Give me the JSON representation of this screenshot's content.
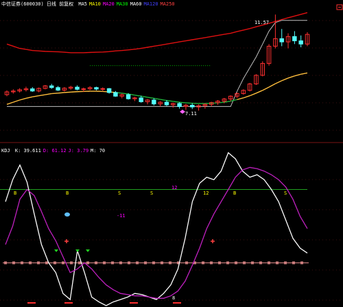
{
  "main_header": {
    "title": "中信证券(600030) 日线 前复权",
    "indicators": [
      {
        "label": "MA5",
        "color": "#ffffff"
      },
      {
        "label": "MA10",
        "color": "#ffff00"
      },
      {
        "label": "MA20",
        "color": "#ff00ff"
      },
      {
        "label": "MA30",
        "color": "#00ff00"
      },
      {
        "label": "MA60",
        "color": "#ffffff"
      },
      {
        "label": "MA120",
        "color": "#4040ff"
      },
      {
        "label": "MA250",
        "color": "#ff4040"
      }
    ]
  },
  "main_annotations": {
    "high_label": "11.57",
    "low_label": "7.11"
  },
  "sub_header": {
    "title": "KDJ",
    "params": [
      {
        "label": "K: 39.611",
        "color": "#ffffff"
      },
      {
        "label": "D: 61.12",
        "color": "#ff00ff"
      },
      {
        "label": "J: 3.79",
        "color": "#ff00ff"
      },
      {
        "label": "M: 70",
        "color": "#ffffff"
      }
    ]
  },
  "signal_labels": [
    {
      "text": "B",
      "color": "#ffff00"
    },
    {
      "text": "B",
      "color": "#ffff00"
    },
    {
      "text": "S",
      "color": "#ffff00"
    },
    {
      "text": "S",
      "color": "#ffff00"
    },
    {
      "text": "12",
      "color": "#ffff00"
    },
    {
      "text": "B",
      "color": "#ffff00"
    },
    {
      "text": "S",
      "color": "#ffff00"
    },
    {
      "text": "12",
      "color": "#ff00ff"
    },
    {
      "text": "-11",
      "color": "#ff00ff"
    },
    {
      "text": "8",
      "color": "#ffffff"
    }
  ],
  "colors": {
    "background": "#000000",
    "up_candle": "#ff3030",
    "down_candle": "#54ffff",
    "ma_long": "#e01010",
    "ma_mid": "#ffbe3c",
    "ma_short_green": "#1eb43c",
    "band": "#c0c0c0",
    "dotted_guide": "#00c000",
    "kdj_k": "#ffffff",
    "kdj_d": "#c020c0",
    "level_line": "#20a020",
    "pink_markers": "#d08080",
    "grid_red": "#802020"
  },
  "chart_data": [
    {
      "type": "candlestick",
      "title": "",
      "candles_ohlc": [
        [
          7.85,
          8.05,
          7.78,
          7.98
        ],
        [
          7.98,
          8.1,
          7.9,
          8.02
        ],
        [
          8.02,
          8.15,
          7.95,
          8.08
        ],
        [
          8.08,
          8.22,
          8.0,
          8.12
        ],
        [
          8.12,
          8.2,
          7.98,
          8.02
        ],
        [
          8.02,
          8.18,
          7.96,
          8.14
        ],
        [
          8.14,
          8.3,
          8.1,
          8.26
        ],
        [
          8.26,
          8.35,
          8.12,
          8.18
        ],
        [
          8.18,
          8.25,
          8.02,
          8.06
        ],
        [
          8.06,
          8.2,
          8.0,
          8.15
        ],
        [
          8.15,
          8.26,
          8.08,
          8.2
        ],
        [
          8.2,
          8.28,
          8.05,
          8.1
        ],
        [
          8.1,
          8.18,
          7.98,
          8.12
        ],
        [
          8.12,
          8.24,
          8.06,
          8.18
        ],
        [
          8.18,
          8.22,
          8.05,
          8.11
        ],
        [
          8.11,
          8.19,
          8.02,
          8.13
        ],
        [
          8.13,
          8.16,
          7.9,
          7.95
        ],
        [
          7.95,
          8.02,
          7.75,
          7.78
        ],
        [
          7.78,
          7.9,
          7.68,
          7.85
        ],
        [
          7.85,
          7.92,
          7.62,
          7.66
        ],
        [
          7.66,
          7.75,
          7.55,
          7.7
        ],
        [
          7.7,
          7.8,
          7.48,
          7.52
        ],
        [
          7.52,
          7.65,
          7.4,
          7.6
        ],
        [
          7.6,
          7.68,
          7.35,
          7.42
        ],
        [
          7.42,
          7.55,
          7.3,
          7.5
        ],
        [
          7.5,
          7.6,
          7.32,
          7.38
        ],
        [
          7.38,
          7.48,
          7.25,
          7.44
        ],
        [
          7.44,
          7.5,
          7.2,
          7.3
        ],
        [
          7.3,
          7.42,
          7.15,
          7.36
        ],
        [
          7.36,
          7.45,
          7.18,
          7.28
        ],
        [
          7.28,
          7.4,
          7.11,
          7.34
        ],
        [
          7.34,
          7.45,
          7.2,
          7.4
        ],
        [
          7.4,
          7.52,
          7.3,
          7.48
        ],
        [
          7.48,
          7.6,
          7.38,
          7.55
        ],
        [
          7.55,
          7.7,
          7.45,
          7.65
        ],
        [
          7.65,
          7.82,
          7.55,
          7.78
        ],
        [
          7.78,
          7.95,
          7.7,
          7.9
        ],
        [
          7.9,
          8.1,
          7.85,
          8.05
        ],
        [
          8.05,
          8.4,
          8.0,
          8.35
        ],
        [
          8.35,
          8.8,
          8.3,
          8.75
        ],
        [
          8.75,
          9.4,
          8.7,
          9.3
        ],
        [
          9.3,
          10.2,
          9.2,
          10.1
        ],
        [
          10.1,
          11.57,
          10.0,
          10.45
        ],
        [
          10.45,
          10.9,
          10.1,
          10.3
        ],
        [
          10.3,
          10.7,
          10.0,
          10.55
        ],
        [
          10.55,
          10.8,
          10.2,
          10.35
        ],
        [
          10.35,
          10.6,
          10.05,
          10.2
        ],
        [
          10.2,
          10.75,
          10.1,
          10.65
        ]
      ],
      "ma_long": [
        10.2,
        10.1,
        10.0,
        9.95,
        9.9,
        9.88,
        9.86,
        9.85,
        9.84,
        9.82,
        9.8,
        9.8,
        9.8,
        9.81,
        9.82,
        9.83,
        9.85,
        9.88,
        9.9,
        9.93,
        9.96,
        10.0,
        10.05,
        10.1,
        10.15,
        10.2,
        10.25,
        10.3,
        10.35,
        10.4,
        10.45,
        10.5,
        10.55,
        10.6,
        10.65,
        10.7,
        10.78,
        10.85,
        10.92,
        11.0,
        11.08,
        11.16,
        11.25,
        11.34,
        11.42,
        11.5,
        11.58,
        11.66
      ],
      "ma_mid": [
        7.4,
        7.5,
        7.6,
        7.68,
        7.75,
        7.8,
        7.85,
        7.9,
        7.92,
        7.95,
        7.97,
        7.99,
        8.0,
        8.01,
        8.01,
        8.0,
        7.98,
        7.95,
        7.92,
        7.88,
        7.83,
        7.78,
        7.73,
        7.68,
        7.63,
        7.58,
        7.54,
        7.5,
        7.47,
        7.45,
        7.44,
        7.44,
        7.45,
        7.47,
        7.5,
        7.55,
        7.62,
        7.7,
        7.8,
        7.92,
        8.05,
        8.2,
        8.36,
        8.5,
        8.62,
        8.72,
        8.8,
        8.86
      ],
      "band_upper": [
        7.3,
        7.3,
        7.3,
        7.3,
        7.3,
        7.3,
        7.3,
        7.3,
        7.3,
        7.3,
        7.3,
        7.3,
        7.3,
        7.3,
        7.3,
        7.3,
        7.3,
        7.3,
        7.3,
        7.3,
        7.3,
        7.3,
        7.3,
        7.3,
        7.3,
        7.3,
        7.3,
        7.3,
        7.3,
        7.3,
        7.3,
        7.3,
        7.3,
        7.3,
        7.3,
        7.3,
        8.0,
        8.6,
        9.1,
        9.6,
        10.2,
        10.8,
        11.2,
        11.3,
        11.3,
        11.3,
        11.3,
        11.3
      ],
      "guide_level": 9.2
    },
    {
      "type": "line",
      "title": "KDJ",
      "ylim": [
        -15,
        115
      ],
      "level_top": 80,
      "level_mid": 20,
      "series": [
        {
          "name": "K",
          "values": [
            70,
            88,
            100,
            86,
            60,
            35,
            20,
            12,
            -5,
            -10,
            30,
            12,
            -8,
            -12,
            -15,
            -12,
            -10,
            -8,
            -5,
            -6,
            -8,
            -10,
            -5,
            2,
            15,
            40,
            70,
            85,
            90,
            88,
            95,
            110,
            105,
            95,
            90,
            92,
            88,
            80,
            70,
            55,
            40,
            32,
            28
          ]
        },
        {
          "name": "D",
          "values": [
            35,
            50,
            72,
            80,
            75,
            62,
            48,
            38,
            25,
            12,
            15,
            20,
            15,
            8,
            2,
            -2,
            -5,
            -6,
            -7,
            -7,
            -8,
            -9,
            -9,
            -7,
            -3,
            5,
            18,
            32,
            48,
            60,
            70,
            80,
            90,
            96,
            98,
            97,
            95,
            92,
            88,
            82,
            72,
            58,
            48
          ]
        }
      ]
    }
  ]
}
